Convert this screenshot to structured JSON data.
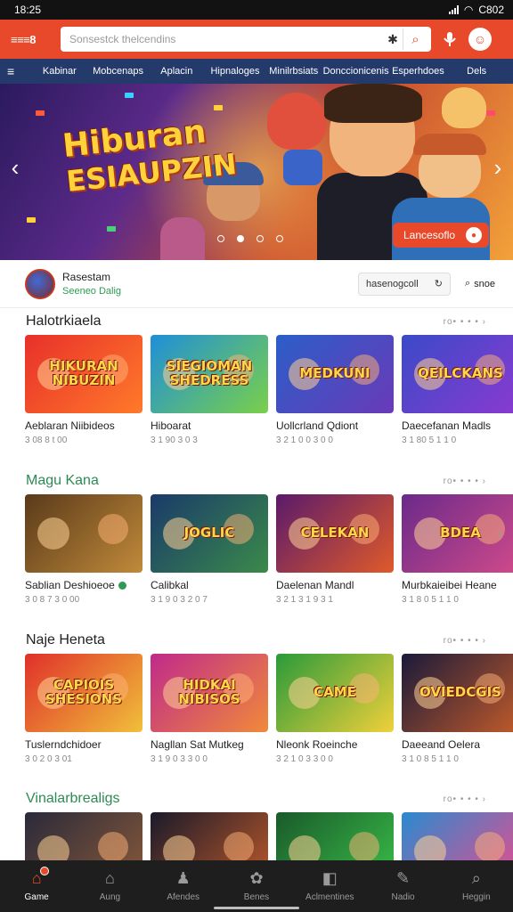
{
  "status": {
    "time": "18:25",
    "battery": "C802"
  },
  "header": {
    "logo": "≡≡≡8",
    "search_placeholder": "Sonsestck thelcendins",
    "clear_icon": "✱",
    "search_icon": "⌕",
    "mic_icon": "mic-icon",
    "profile_icon": "face-icon"
  },
  "categories": {
    "menu_icon": "≡",
    "items": [
      "Kabinar",
      "Mobcenaps",
      "Aplacin",
      "Hipnaloges",
      "Minilrbsiats",
      "Donccionicenis",
      "Esperhdoes",
      "Dels"
    ]
  },
  "hero": {
    "title_line1": "Hiburan",
    "title_line2": "ESIAUPZIN",
    "cta_label": "Lancesoflo",
    "dots": [
      false,
      true,
      false,
      false
    ],
    "prev_icon": "‹",
    "next_icon": "›"
  },
  "profile": {
    "name": "Rasestam",
    "subtitle": "Seeneo Dalig",
    "button_label": "hasenogcoll",
    "more_label": "snoe"
  },
  "sections": [
    {
      "title": "Halotrkiaela",
      "green": false,
      "more": "ro• • • •",
      "cards": [
        {
          "name": "Aeblaran Niibideos",
          "meta": "3 08 8 t 00",
          "thumb": "HIKURAN NIBUZIN",
          "tag": false
        },
        {
          "name": "Hiboarat",
          "meta": "3 1 90 3 0 3",
          "thumb": "SIEGIOMAN SHEDRESS",
          "tag": false
        },
        {
          "name": "Uollcrland Qdiont",
          "meta": "3 2 1 0 0 3 0 0",
          "thumb": "MEDKUNI",
          "tag": false
        },
        {
          "name": "Daecefanan Madls",
          "meta": "3 1 80 5 1 1 0",
          "thumb": "QEILCKANS",
          "tag": false
        }
      ]
    },
    {
      "title": "Magu Kana",
      "green": true,
      "more": "ro• • • •",
      "cards": [
        {
          "name": "Sablian Deshioeoe",
          "meta": "3 0 8 7 3 0 00",
          "thumb": "",
          "tag": true
        },
        {
          "name": "Calibkal",
          "meta": "3 1 9 0 3 2 0 7",
          "thumb": "JOGLIC",
          "tag": false
        },
        {
          "name": "Daelenan Mandl",
          "meta": "3 2 1 3 1 9 3 1",
          "thumb": "CELEKAN",
          "tag": false
        },
        {
          "name": "Murbkaieibei Heane",
          "meta": "3 1 8 0 5 1 1 0",
          "thumb": "BDEA",
          "tag": false
        }
      ]
    },
    {
      "title": "Naje Heneta",
      "green": false,
      "more": "ro• • • •",
      "cards": [
        {
          "name": "Tuslerndchidoer",
          "meta": "3 0 2 0 3 01",
          "thumb": "CAPIOIS SHESIONS",
          "tag": false
        },
        {
          "name": "Nagllan Sat Mutkeg",
          "meta": "3 1 9 0 3 3 0 0",
          "thumb": "HIDKAI NIBISOS",
          "tag": false
        },
        {
          "name": "Nleonk Roeinche",
          "meta": "3 2 1 0 3 3 0 0",
          "thumb": "CAME",
          "tag": false
        },
        {
          "name": "Daeeand Oelera",
          "meta": "3 1 0 8 5 1 1 0",
          "thumb": "OVIEDCGIS",
          "tag": false
        }
      ]
    },
    {
      "title": "Vinalarbrealigs",
      "green": true,
      "more": "ro• • • •",
      "cards": [
        {
          "name": "",
          "meta": "",
          "thumb": "",
          "tag": false
        },
        {
          "name": "",
          "meta": "",
          "thumb": "",
          "tag": false
        },
        {
          "name": "",
          "meta": "",
          "thumb": "",
          "tag": false
        },
        {
          "name": "",
          "meta": "",
          "thumb": "",
          "tag": false
        }
      ]
    }
  ],
  "bottom_nav": [
    {
      "label": "Game",
      "icon": "⌂",
      "active": true,
      "badge": true
    },
    {
      "label": "Aung",
      "icon": "⌂",
      "active": false,
      "badge": false
    },
    {
      "label": "Afendes",
      "icon": "♟",
      "active": false,
      "badge": false
    },
    {
      "label": "Benes",
      "icon": "✿",
      "active": false,
      "badge": false
    },
    {
      "label": "Aclmentines",
      "icon": "◧",
      "active": false,
      "badge": false
    },
    {
      "label": "Nadio",
      "icon": "✎",
      "active": false,
      "badge": false
    },
    {
      "label": "Heggin",
      "icon": "⌕",
      "active": false,
      "badge": false
    }
  ],
  "colors": {
    "brand": "#e8492a",
    "nav_blue": "#243a6b",
    "green": "#2e8a55",
    "bottom_bar": "#1e1e1e"
  }
}
